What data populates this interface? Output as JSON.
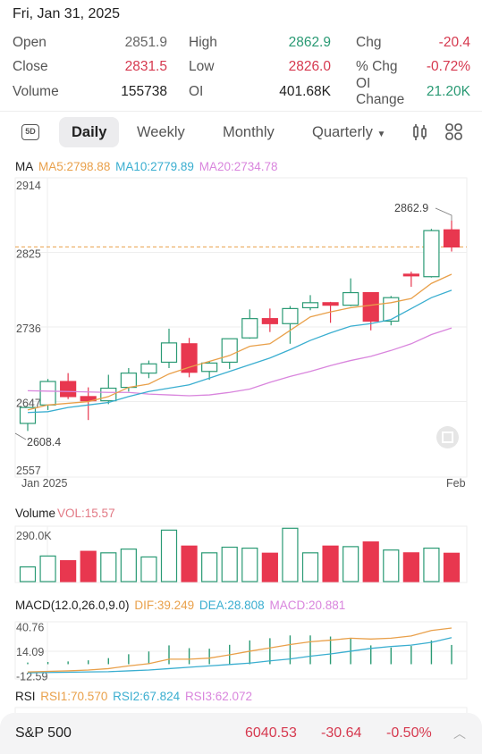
{
  "header": {
    "date": "Fri, Jan 31, 2025"
  },
  "stats": [
    [
      {
        "label": "Open",
        "value": "2851.9",
        "color": "gray"
      },
      {
        "label": "High",
        "value": "2862.9",
        "color": "green"
      },
      {
        "label": "Chg",
        "value": "-20.4",
        "color": "red"
      }
    ],
    [
      {
        "label": "Close",
        "value": "2831.5",
        "color": "red"
      },
      {
        "label": "Low",
        "value": "2826.0",
        "color": "red"
      },
      {
        "label": "% Chg",
        "value": "-0.72%",
        "color": "red"
      }
    ],
    [
      {
        "label": "Volume",
        "value": "155738",
        "color": "dark"
      },
      {
        "label": "OI",
        "value": "401.68K",
        "color": "dark"
      },
      {
        "label": "OI Change",
        "value": "21.20K",
        "color": "green"
      }
    ]
  ],
  "tabs": {
    "fiveday": "5D",
    "daily": "Daily",
    "weekly": "Weekly",
    "monthly": "Monthly",
    "quarterly": "Quarterly",
    "active": "Daily"
  },
  "colors": {
    "up": "#2a9a74",
    "down": "#e8374f",
    "ma5": "#e9a04a",
    "ma10": "#3aaed0",
    "ma20": "#d985dd"
  },
  "ma_legend": {
    "title": "MA",
    "ma5": "MA5:2798.88",
    "ma10": "MA10:2779.89",
    "ma20": "MA20:2734.78"
  },
  "vol_legend": {
    "title": "Volume",
    "vol": "VOL:15.57"
  },
  "macd_legend": {
    "title": "MACD(12.0,26.0,9.0)",
    "dif": "DIF:39.249",
    "dea": "DEA:28.808",
    "macd": "MACD:20.881"
  },
  "rsi_legend": {
    "title": "RSI",
    "rsi1": "RSI1:70.570",
    "rsi2": "RSI2:67.824",
    "rsi3": "RSI3:62.072"
  },
  "chart_data": [
    {
      "type": "candlestick",
      "yticks": [
        "2914",
        "2825",
        "2736",
        "2647",
        "2557"
      ],
      "ylim": [
        2557,
        2914
      ],
      "xlabels": [
        "Jan 2025",
        "Feb"
      ],
      "high_label": "2862.9",
      "low_label": "2608.4",
      "last_close": 2831.5,
      "ohlc": [
        [
          2621,
          2640,
          2612,
          2640
        ],
        [
          2643,
          2674,
          2637,
          2671
        ],
        [
          2671,
          2681,
          2650,
          2653
        ],
        [
          2653,
          2664,
          2625,
          2648
        ],
        [
          2648,
          2679,
          2644,
          2663
        ],
        [
          2664,
          2687,
          2659,
          2681
        ],
        [
          2681,
          2696,
          2675,
          2692
        ],
        [
          2694,
          2734,
          2687,
          2717
        ],
        [
          2716,
          2723,
          2676,
          2682
        ],
        [
          2683,
          2695,
          2673,
          2693
        ],
        [
          2694,
          2722,
          2686,
          2722
        ],
        [
          2723,
          2757,
          2722,
          2746
        ],
        [
          2746,
          2758,
          2730,
          2740
        ],
        [
          2740,
          2761,
          2716,
          2758
        ],
        [
          2759,
          2774,
          2756,
          2765
        ],
        [
          2765,
          2766,
          2741,
          2762
        ],
        [
          2762,
          2794,
          2761,
          2777
        ],
        [
          2777,
          2777,
          2732,
          2743
        ],
        [
          2743,
          2773,
          2738,
          2771
        ],
        [
          2799,
          2802,
          2784,
          2797
        ],
        [
          2796,
          2853,
          2795,
          2851
        ],
        [
          2851.9,
          2862.9,
          2826.0,
          2831.5
        ]
      ],
      "ma5": [
        2637,
        2643,
        2645,
        2647,
        2653,
        2664,
        2668,
        2680,
        2688,
        2695,
        2702,
        2713,
        2716,
        2732,
        2748,
        2754,
        2759,
        2762,
        2765,
        2770,
        2788,
        2798.88
      ],
      "ma10": [
        2634,
        2635,
        2640,
        2643,
        2646,
        2653,
        2659,
        2663,
        2667,
        2675,
        2683,
        2691,
        2699,
        2709,
        2720,
        2729,
        2737,
        2740,
        2745,
        2758,
        2771,
        2779.89
      ],
      "ma20": [
        2660,
        2659.5,
        2659,
        2658.5,
        2658,
        2658,
        2656,
        2655,
        2654,
        2655,
        2658,
        2662,
        2670,
        2677,
        2683,
        2690,
        2696,
        2701,
        2708,
        2716,
        2727,
        2734.78
      ]
    },
    {
      "type": "bar",
      "name": "Volume",
      "ytick": "290.0K",
      "ymax": 300000,
      "values": [
        83000,
        141000,
        116000,
        166000,
        158000,
        178000,
        136000,
        279000,
        194000,
        158000,
        188000,
        183000,
        156000,
        289000,
        158000,
        194000,
        191000,
        216000,
        173000,
        158000,
        183000,
        155738
      ]
    },
    {
      "type": "line",
      "name": "MACD",
      "yticks": [
        "40.76",
        "14.09",
        "-12.59"
      ],
      "ylim": [
        -16,
        46
      ],
      "dif": [
        -8.4,
        -7.8,
        -7.2,
        -6.3,
        -4.8,
        -1.8,
        0.6,
        5.4,
        5.4,
        6.6,
        10.2,
        14.1,
        17.7,
        21.3,
        24.3,
        26.1,
        28.2,
        27.3,
        28.2,
        30.6,
        36.6,
        39.249
      ],
      "dea": [
        -9.3,
        -9,
        -8.7,
        -8.4,
        -8.1,
        -7.2,
        -6.3,
        -4.8,
        -3.3,
        -1.8,
        -0.3,
        1.2,
        3.6,
        5.7,
        8.7,
        11.1,
        14.1,
        17.1,
        19.2,
        20.7,
        23.7,
        28.808
      ]
    }
  ],
  "footer": {
    "name": "S&P 500",
    "price": "6040.53",
    "change": "-30.64",
    "pct": "-0.50%"
  }
}
